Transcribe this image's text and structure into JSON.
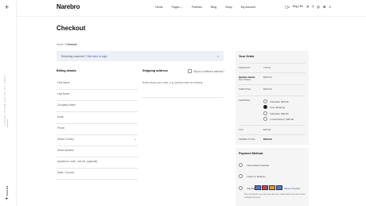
{
  "sidebar": {
    "plus_symbol": "+",
    "vertical_text": "LOREM IPSUM DOLOR SIT AMET",
    "share_label": "SHARE"
  },
  "header": {
    "logo": "Narebro",
    "nav": [
      "Home",
      "Pages",
      "Portfolio",
      "Blog",
      "Shop",
      "My Account"
    ],
    "cart_count": "0",
    "language": "Eng",
    "currency": "En"
  },
  "page": {
    "title": "Checkout",
    "breadcrumb_home": "Home",
    "breadcrumb_sep": " / ",
    "breadcrumb_current": "Checkout"
  },
  "notice": {
    "text": "Returning customer?",
    "link": "Click here to login"
  },
  "billing": {
    "heading": "Billing details",
    "fields": [
      "First Name",
      "Last Name",
      "Company Name",
      "Email",
      "Phone",
      "Select Country",
      "Street address",
      "Apartment, suite, unit etc. (optional)",
      "State / Country"
    ]
  },
  "shipping": {
    "heading": "Shipping address",
    "different_label": "Ship to a different address?",
    "notes_placeholder": "Notes about your order, e.g. special notes for delivery."
  },
  "order": {
    "heading": "Your Order",
    "product_label": "PRODUCT",
    "total_label": "TOTAL",
    "item_name": "Quilted Jacket",
    "item_qty": "Size: Medium",
    "item_total": "$455.00",
    "subtotal_label": "SUBTOTAL",
    "subtotal_value": "$455.00",
    "shipping_label": "SHIPPING",
    "shipping_options": [
      "Flat Rate: $15.00",
      "Free Shipping",
      "Flat Rate: $40.00",
      "Local Delivery: $25.00"
    ],
    "selected_shipping_index": 1,
    "tax_label": "TAX",
    "tax_value": "$15.00",
    "order_total_label": "ORDER TOTAL",
    "order_total_value": "$455.00"
  },
  "payment": {
    "heading": "Payment Method",
    "options": [
      "Direct Bank Transfer",
      "Cash on Delivery",
      "PayPal"
    ],
    "paypal_link": "What is PayPal?",
    "paypal_note": "Pay via PayPal; you can pay with your credit card if you don't have a PayPal account."
  }
}
